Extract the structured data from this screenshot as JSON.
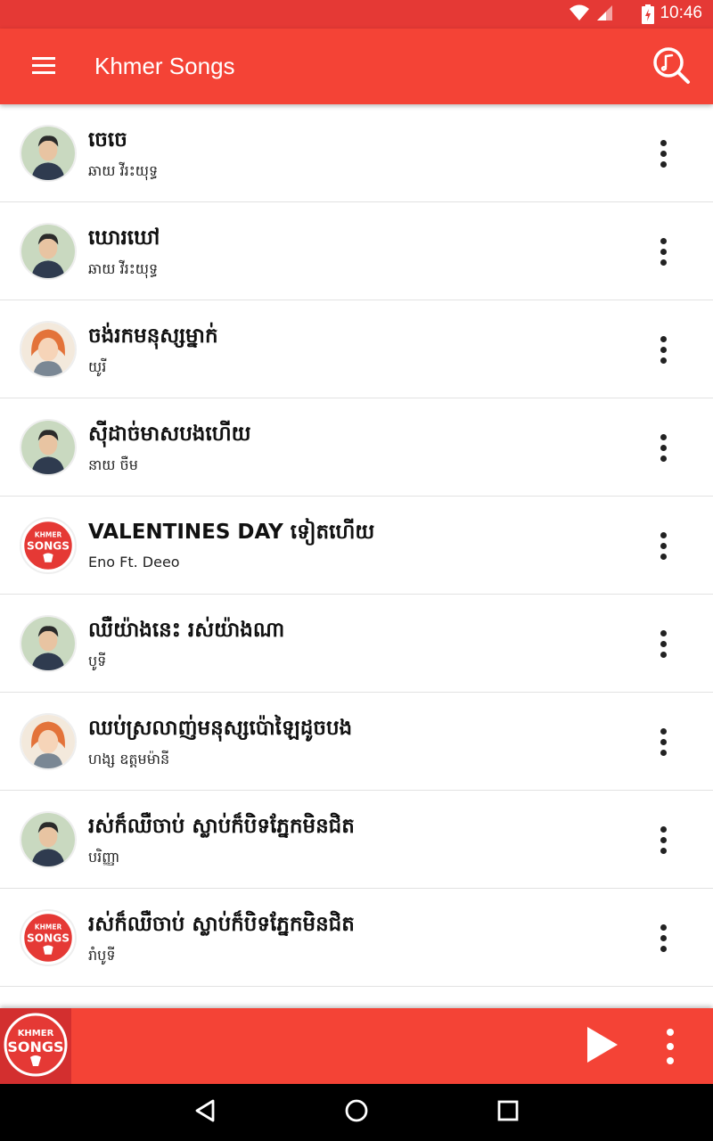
{
  "status_bar": {
    "time": "10:46",
    "icons": [
      "wifi-icon",
      "signal-icon",
      "battery-charging-icon"
    ]
  },
  "app_bar": {
    "title": "Khmer Songs",
    "menu_icon": "hamburger-menu-icon",
    "search_icon": "search-icon"
  },
  "songs": [
    {
      "title": "ចេចេ",
      "artist": "ឆាយ វីរះយុទ្ធ",
      "art": "photo-male-singer"
    },
    {
      "title": "ឃោរឃៅ",
      "artist": "ឆាយ វីរះយុទ្ធ",
      "art": "photo-male-singer"
    },
    {
      "title": "ចង់រកមនុស្សម្នាក់",
      "artist": "យូរី",
      "art": "photo-female-singer"
    },
    {
      "title": "ស៊ីដាច់មាសបងហើយ",
      "artist": "នាយ ចឺម",
      "art": "photo-male-singer"
    },
    {
      "title": "VALENTINES DAY ទៀតហើយ",
      "artist": "Eno Ft. Deeo",
      "art": "khmer-songs-logo"
    },
    {
      "title": "ឈឺយ៉ាងនេះ រស់យ៉ាងណា",
      "artist": "បូទី",
      "art": "photo-male-singer"
    },
    {
      "title": "ឈប់ស្រលាញ់មនុស្សប៉ោឡៃដូចបង",
      "artist": "ហង្ស ឧត្តមម៉ានី",
      "art": "photo-female-singer"
    },
    {
      "title": "រស់ក៏ឈឺចាប់ ស្លាប់ក៏បិទភ្នែកមិនជិត",
      "artist": "បរិញ្ញា",
      "art": "photo-male-singer"
    },
    {
      "title": "រស់ក៏ឈឺចាប់ ស្លាប់ក៏បិទភ្នែកមិនជិត",
      "artist": "រាំបូទី",
      "art": "khmer-songs-logo"
    }
  ],
  "logo": {
    "line1": "KHMER",
    "line2": "SONGS"
  },
  "mini_player": {
    "play_icon": "play-icon",
    "more_icon": "more-vert-icon"
  },
  "nav_bar": {
    "icons": [
      "back-icon",
      "home-icon",
      "recents-icon"
    ]
  },
  "colors": {
    "primary": "#f44336",
    "status_bar": "#e53935",
    "accent_dark": "#d32f2f"
  }
}
